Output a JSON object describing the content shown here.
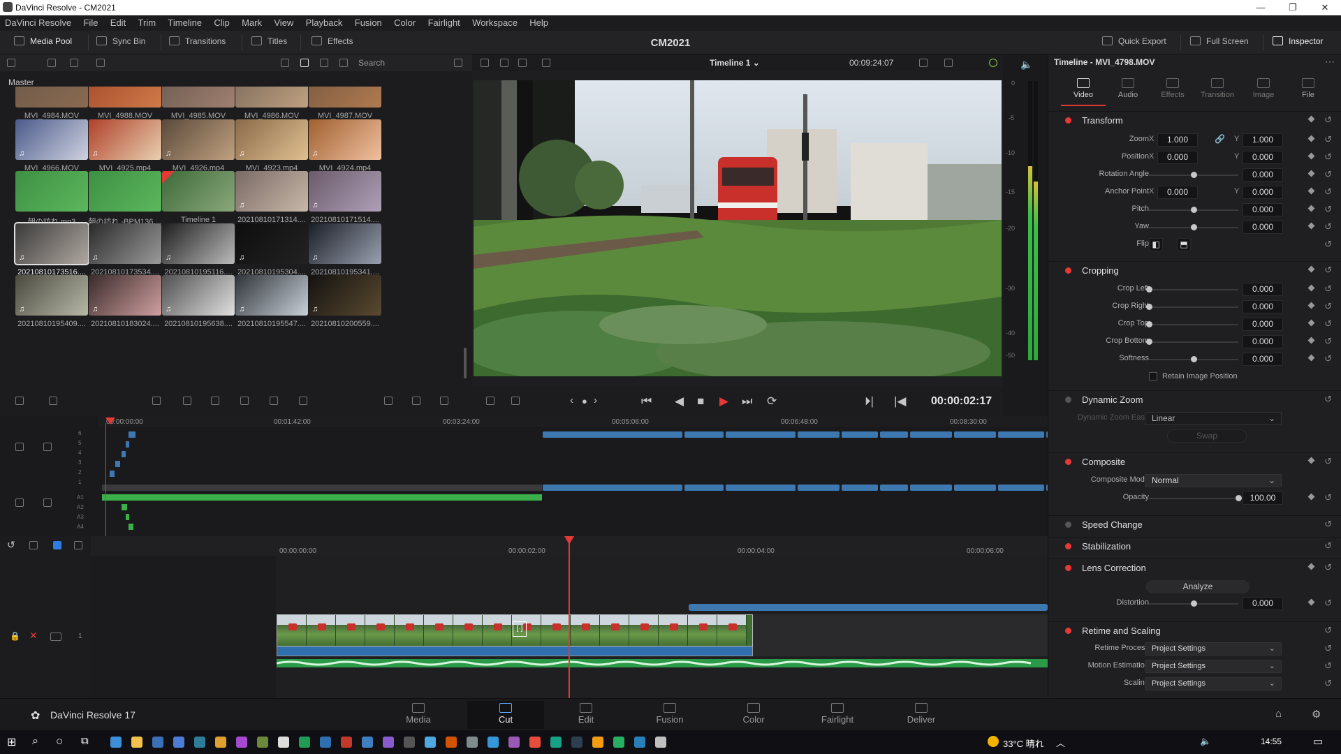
{
  "window": {
    "title": "DaVinci Resolve - CM2021",
    "minimize": "—",
    "maximize": "❐",
    "close": "✕"
  },
  "menu": [
    "DaVinci Resolve",
    "File",
    "Edit",
    "Trim",
    "Timeline",
    "Clip",
    "Mark",
    "View",
    "Playback",
    "Fusion",
    "Color",
    "Fairlight",
    "Workspace",
    "Help"
  ],
  "toolbar": {
    "media_pool": "Media Pool",
    "sync_bin": "Sync Bin",
    "transitions": "Transitions",
    "titles": "Titles",
    "effects": "Effects",
    "project_title": "CM2021",
    "quick_export": "Quick Export",
    "full_screen": "Full Screen",
    "inspector": "Inspector"
  },
  "media_pool": {
    "search_placeholder": "Search",
    "bin": "Master",
    "clips": [
      {
        "name": "MVI_4984.MOV"
      },
      {
        "name": "MVI_4988.MOV"
      },
      {
        "name": "MVI_4985.MOV"
      },
      {
        "name": "MVI_4986.MOV"
      },
      {
        "name": "MVI_4987.MOV"
      },
      {
        "name": "MVI_4966.MOV",
        "audio": "♫"
      },
      {
        "name": "MVI_4925.mp4",
        "audio": "♫"
      },
      {
        "name": "MVI_4926.mp4",
        "audio": "♫"
      },
      {
        "name": "MVI_4923.mp4",
        "audio": "♫"
      },
      {
        "name": "MVI_4924.mp4",
        "audio": "♫"
      },
      {
        "name": "朝の訪れ.mp3"
      },
      {
        "name": "朝の訪れ -BPM136...."
      },
      {
        "name": "Timeline 1"
      },
      {
        "name": "20210810171314....",
        "audio": "♫"
      },
      {
        "name": "20210810171514....",
        "audio": "♫"
      },
      {
        "name": "20210810173516....",
        "audio": "♫"
      },
      {
        "name": "20210810173534....",
        "audio": "♫"
      },
      {
        "name": "20210810195116....",
        "audio": "♫"
      },
      {
        "name": "20210810195304....",
        "audio": "♫"
      },
      {
        "name": "20210810195341....",
        "audio": "♫"
      },
      {
        "name": "20210810195409....",
        "audio": "♫"
      },
      {
        "name": "20210810183024....",
        "audio": "♫"
      },
      {
        "name": "20210810195638....",
        "audio": "♫"
      },
      {
        "name": "20210810195547....",
        "audio": "♫"
      },
      {
        "name": "20210810200559....",
        "audio": "♫"
      }
    ]
  },
  "viewer": {
    "timeline_name": "Timeline 1 ⌄",
    "duration": "00:09:24:07",
    "timecode": "00:00:02:17"
  },
  "meter": {
    "ticks": [
      "0",
      "-5",
      "-10",
      "-15",
      "-20",
      "-30",
      "-40",
      "-50"
    ]
  },
  "upper_timeline": {
    "ruler": [
      "00:00:00:00",
      "00:01:42:00",
      "00:03:24:00",
      "00:05:06:00",
      "00:06:48:00",
      "00:08:30:00"
    ],
    "tracks": [
      "6",
      "5",
      "4",
      "3",
      "2",
      "1",
      "A1",
      "A2",
      "A3",
      "A4"
    ]
  },
  "lower_timeline": {
    "ruler": [
      "00:00:00:00",
      "00:00:02:00",
      "00:00:04:00",
      "00:00:06:00"
    ],
    "track_number": "1"
  },
  "inspector": {
    "title": "Timeline - MVI_4798.MOV",
    "tabs": [
      "Video",
      "Audio",
      "Effects",
      "Transition",
      "Image",
      "File"
    ],
    "transform": {
      "header": "Transform",
      "zoom_label": "Zoom",
      "zoom_x": "1.000",
      "zoom_y": "1.000",
      "position_label": "Position",
      "position_x": "0.000",
      "position_y": "0.000",
      "rotation_label": "Rotation Angle",
      "rotation": "0.000",
      "anchor_label": "Anchor Point",
      "anchor_x": "0.000",
      "anchor_y": "0.000",
      "pitch_label": "Pitch",
      "pitch": "0.000",
      "yaw_label": "Yaw",
      "yaw": "0.000",
      "flip_label": "Flip",
      "x": "X",
      "y": "Y"
    },
    "cropping": {
      "header": "Cropping",
      "left_label": "Crop Left",
      "left": "0.000",
      "right_label": "Crop Right",
      "right": "0.000",
      "top_label": "Crop Top",
      "top": "0.000",
      "bottom_label": "Crop Bottom",
      "bottom": "0.000",
      "softness_label": "Softness",
      "softness": "0.000",
      "retain": "Retain Image Position"
    },
    "dynamic_zoom": {
      "header": "Dynamic Zoom",
      "ease_label": "Dynamic Zoom Ease",
      "ease": "Linear",
      "swap": "Swap"
    },
    "composite": {
      "header": "Composite",
      "mode_label": "Composite Mode",
      "mode": "Normal",
      "opacity_label": "Opacity",
      "opacity": "100.00"
    },
    "speed_change": "Speed Change",
    "stabilization": "Stabilization",
    "lens": {
      "header": "Lens Correction",
      "analyze": "Analyze",
      "distortion_label": "Distortion",
      "distortion": "0.000"
    },
    "retime": {
      "header": "Retime and Scaling",
      "process_label": "Retime Process",
      "process": "Project Settings",
      "motion_label": "Motion Estimation",
      "motion": "Project Settings",
      "scaling_label": "Scaling",
      "scaling": "Project Settings"
    }
  },
  "pages": {
    "app": "DaVinci Resolve 17",
    "items": [
      "Media",
      "Cut",
      "Edit",
      "Fusion",
      "Color",
      "Fairlight",
      "Deliver"
    ],
    "active": "Cut"
  },
  "taskbar": {
    "weather": "33°C 晴れ",
    "time": "14:55"
  }
}
